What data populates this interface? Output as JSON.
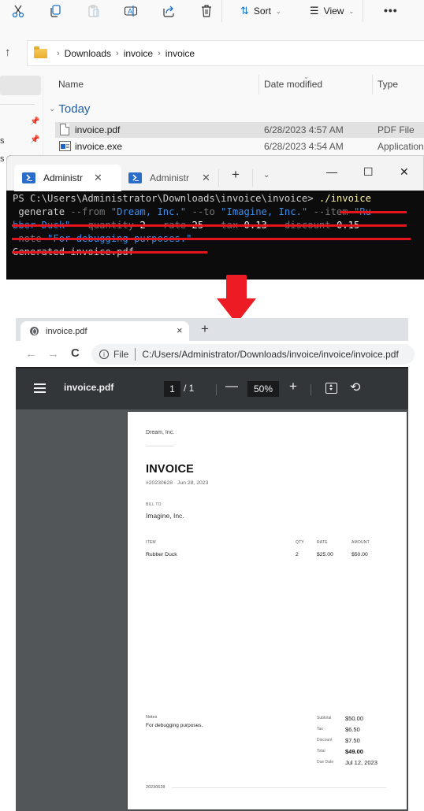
{
  "explorer": {
    "toolbar": {
      "icons": [
        "cut-icon",
        "copy-icon",
        "paste-icon",
        "rename-icon",
        "share-icon",
        "delete-icon"
      ],
      "sort_label": "Sort",
      "view_label": "View",
      "more_label": "•••"
    },
    "breadcrumb": [
      "Downloads",
      "invoice",
      "invoice"
    ],
    "columns": {
      "name": "Name",
      "date": "Date modified",
      "type": "Type"
    },
    "group": "Today",
    "nav_partial_labels": [
      "s",
      "s"
    ],
    "files": [
      {
        "name": "invoice.pdf",
        "date": "6/28/2023 4:57 AM",
        "type": "PDF File",
        "icon": "pdf-file-icon",
        "selected": true
      },
      {
        "name": "invoice.exe",
        "date": "6/28/2023 4:54 AM",
        "type": "Application",
        "icon": "exe-file-icon",
        "selected": false
      }
    ]
  },
  "terminal": {
    "tabs": [
      {
        "label": "Administr",
        "active": true
      },
      {
        "label": "Administr",
        "active": false
      }
    ],
    "new_tab": "+",
    "dropdown": "⌄",
    "window_controls": {
      "minimize": "—",
      "maximize": "☐",
      "close": "✕"
    },
    "lines": [
      [
        {
          "t": "PS C:\\Users\\Administrator\\Downloads\\invoice\\invoice> ",
          "c": "default"
        },
        {
          "t": "./invoice",
          "c": "yellow"
        }
      ],
      [
        {
          "t": " generate ",
          "c": "default"
        },
        {
          "t": "--from ",
          "c": "gray"
        },
        {
          "t": "\"Dream, Inc.\" ",
          "c": "blue"
        },
        {
          "t": "--to ",
          "c": "gray"
        },
        {
          "t": "\"Imagine, Inc.\" ",
          "c": "blue"
        },
        {
          "t": "--item ",
          "c": "gray"
        },
        {
          "t": "\"Ru",
          "c": "blue"
        }
      ],
      [
        {
          "t": "bber Duck\" ",
          "c": "blue"
        },
        {
          "t": "--quantity ",
          "c": "gray"
        },
        {
          "t": "2 ",
          "c": "white"
        },
        {
          "t": "--rate ",
          "c": "gray"
        },
        {
          "t": "25 ",
          "c": "white"
        },
        {
          "t": "--tax ",
          "c": "gray"
        },
        {
          "t": "0.13 ",
          "c": "white"
        },
        {
          "t": "--discount ",
          "c": "gray"
        },
        {
          "t": "0.15 ",
          "c": "white"
        },
        {
          "t": "-",
          "c": "gray"
        }
      ],
      [
        {
          "t": "-note ",
          "c": "gray"
        },
        {
          "t": "\"For debugging purposes.\"",
          "c": "blue"
        }
      ],
      [
        {
          "t": "Generated invoice.pdf",
          "c": "default"
        }
      ]
    ],
    "annotation_color": "#e8141d"
  },
  "arrow_color": "#ed1c24",
  "browser": {
    "tab_title": "invoice.pdf",
    "tab_close": "×",
    "new_tab": "+",
    "omnibox": {
      "scheme_label": "File",
      "url": "C:/Users/Administrator/Downloads/invoice/invoice/invoice.pdf"
    },
    "pdf_viewer": {
      "title": "invoice.pdf",
      "current_page": "1",
      "total_pages": "/  1",
      "zoom": "50%",
      "zoom_minus": "—",
      "zoom_plus": "+"
    }
  },
  "invoice": {
    "from": "Dream, Inc.",
    "title": "INVOICE",
    "meta": "#20230628  ·  Jun 28, 2023",
    "bill_to_label": "BILL TO",
    "bill_to": "Imagine, Inc.",
    "table": {
      "headers": {
        "item": "ITEM",
        "qty": "QTY",
        "rate": "RATE",
        "amount": "AMOUNT"
      },
      "rows": [
        {
          "item": "Rubber Duck",
          "qty": "2",
          "rate": "$25.00",
          "amount": "$50.00"
        }
      ]
    },
    "notes_label": "Notes",
    "notes": "For debugging purposes.",
    "summary": [
      {
        "label": "Subtotal",
        "value": "$50.00",
        "bold": false
      },
      {
        "label": "Tax",
        "value": "$6.50",
        "bold": false
      },
      {
        "label": "Discount",
        "value": "$7.50",
        "bold": false
      },
      {
        "label": "Total",
        "value": "$49.00",
        "bold": true
      },
      {
        "label": "Due Date",
        "value": "Jul 12, 2023",
        "bold": false
      }
    ],
    "footer_number": "20230628"
  }
}
